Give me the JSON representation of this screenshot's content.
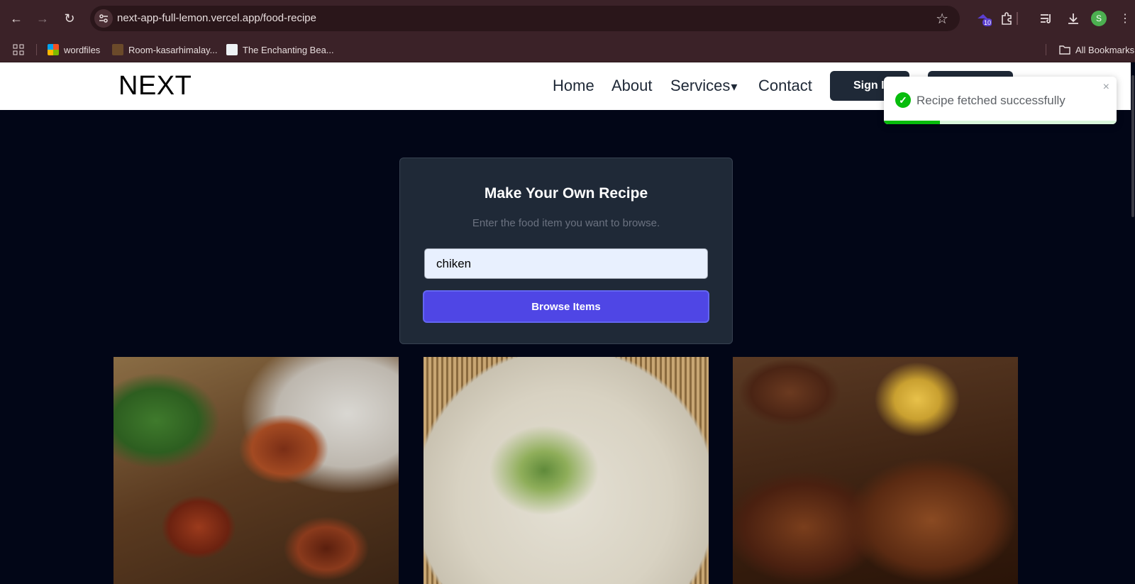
{
  "browser": {
    "url": "next-app-full-lemon.vercel.app/food-recipe",
    "extension_badge": "10",
    "profile_initial": "S",
    "bookmarks": [
      {
        "label": "wordfiles"
      },
      {
        "label": "Room-kasarhimalay..."
      },
      {
        "label": "The Enchanting Bea..."
      }
    ],
    "all_bookmarks_label": "All Bookmarks"
  },
  "site": {
    "logo": "NEXT",
    "nav": {
      "home": "Home",
      "about": "About",
      "services": "Services",
      "contact": "Contact"
    },
    "sign_in": "Sign In"
  },
  "toast": {
    "message": "Recipe fetched successfully",
    "close": "×",
    "progress": 0.24,
    "color": "#07bc0c"
  },
  "form": {
    "title": "Make Your Own Recipe",
    "subtitle": "Enter the food item you want to browse.",
    "input_value": "chiken",
    "button_label": "Browse Items"
  },
  "recipes": [
    {
      "icon": "chicken-tikka-image"
    },
    {
      "icon": "congee-image"
    },
    {
      "icon": "grilled-chicken-image"
    }
  ],
  "colors": {
    "page_bg": "#020617",
    "card_bg": "#1f2937",
    "button_accent": "#4f46e5",
    "chrome_bg": "#3b2228"
  }
}
